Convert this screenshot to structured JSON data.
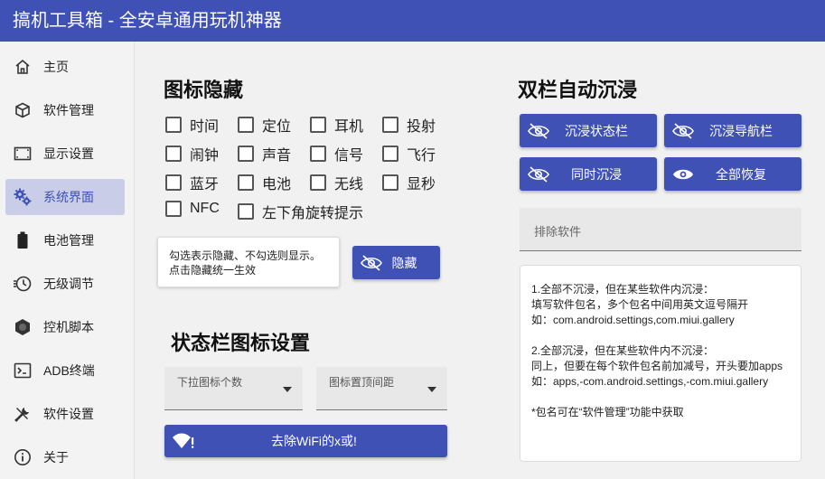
{
  "app": {
    "title": "搞机工具箱 - 全安卓通用玩机神器"
  },
  "sidebar": {
    "items": [
      {
        "label": "主页",
        "icon": "home-icon"
      },
      {
        "label": "软件管理",
        "icon": "cube-icon"
      },
      {
        "label": "显示设置",
        "icon": "screen-icon"
      },
      {
        "label": "系统界面",
        "icon": "gears-icon",
        "active": true
      },
      {
        "label": "电池管理",
        "icon": "battery-icon"
      },
      {
        "label": "无级调节",
        "icon": "timer-icon"
      },
      {
        "label": "控机脚本",
        "icon": "hexagon-icon"
      },
      {
        "label": "ADB终端",
        "icon": "terminal-icon"
      },
      {
        "label": "软件设置",
        "icon": "tools-icon"
      },
      {
        "label": "关于",
        "icon": "info-icon"
      }
    ]
  },
  "icon_hide": {
    "title": "图标隐藏",
    "checkboxes": [
      "时间",
      "定位",
      "耳机",
      "投射",
      "闹钟",
      "声音",
      "信号",
      "飞行",
      "蓝牙",
      "电池",
      "无线",
      "显秒",
      "NFC",
      "左下角旋转提示"
    ],
    "tip_line1": "勾选表示隐藏、不勾选则显示。",
    "tip_line2": "点击隐藏统一生效",
    "hide_button": "隐藏"
  },
  "statusbar": {
    "title": "状态栏图标设置",
    "select1_label": "下拉图标个数",
    "select2_label": "图标置顶间距",
    "wifi_button": "去除WiFi的x或!"
  },
  "immersive": {
    "title": "双栏自动沉浸",
    "btn_status": "沉浸状态栏",
    "btn_nav": "沉浸导航栏",
    "btn_both": "同时沉浸",
    "btn_restore": "全部恢复",
    "exclude_placeholder": "排除软件",
    "notes": {
      "l1": "1.全部不沉浸，但在某些软件内沉浸：",
      "l2": "填写软件包名，多个包名中间用英文逗号隔开",
      "l3": "如：com.android.settings,com.miui.gallery",
      "l4": "2.全部沉浸，但在某些软件内不沉浸：",
      "l5": "同上，但要在每个软件包名前加减号，开头要加apps",
      "l6": "如：apps,-com.android.settings,-com.miui.gallery",
      "l7": "*包名可在“软件管理”功能中获取"
    }
  },
  "colors": {
    "accent": "#3f51b5",
    "active_bg": "#c9cde8"
  }
}
